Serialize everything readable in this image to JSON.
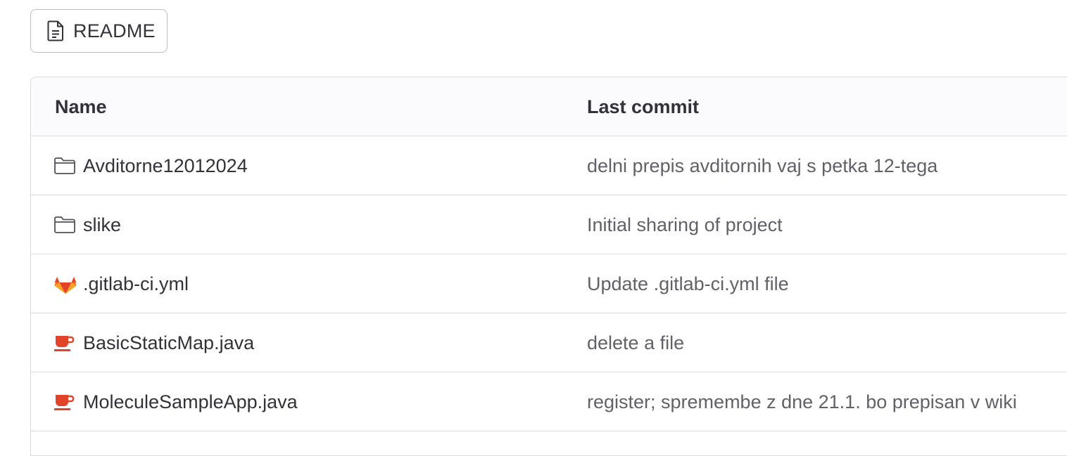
{
  "readme_button": {
    "label": "README",
    "icon": "document-icon"
  },
  "table": {
    "columns": {
      "name": "Name",
      "last_commit": "Last commit"
    },
    "rows": [
      {
        "icon": "folder-icon",
        "name": "Avditorne12012024",
        "commit": "delni prepis avditornih vaj s petka 12-tega"
      },
      {
        "icon": "folder-icon",
        "name": "slike",
        "commit": "Initial sharing of project"
      },
      {
        "icon": "gitlab-icon",
        "name": ".gitlab-ci.yml",
        "commit": "Update .gitlab-ci.yml file"
      },
      {
        "icon": "java-icon",
        "name": "BasicStaticMap.java",
        "commit": "delete a file"
      },
      {
        "icon": "java-icon",
        "name": "MoleculeSampleApp.java",
        "commit": "register; spremembe z dne 21.1. bo prepisan v wiki"
      }
    ]
  },
  "colors": {
    "text": "#333238",
    "muted_text": "#626168",
    "border": "#dcdcde",
    "header_bg": "#fbfafd",
    "java_red": "#e24329",
    "gitlab_orange": "#fc6d26"
  }
}
